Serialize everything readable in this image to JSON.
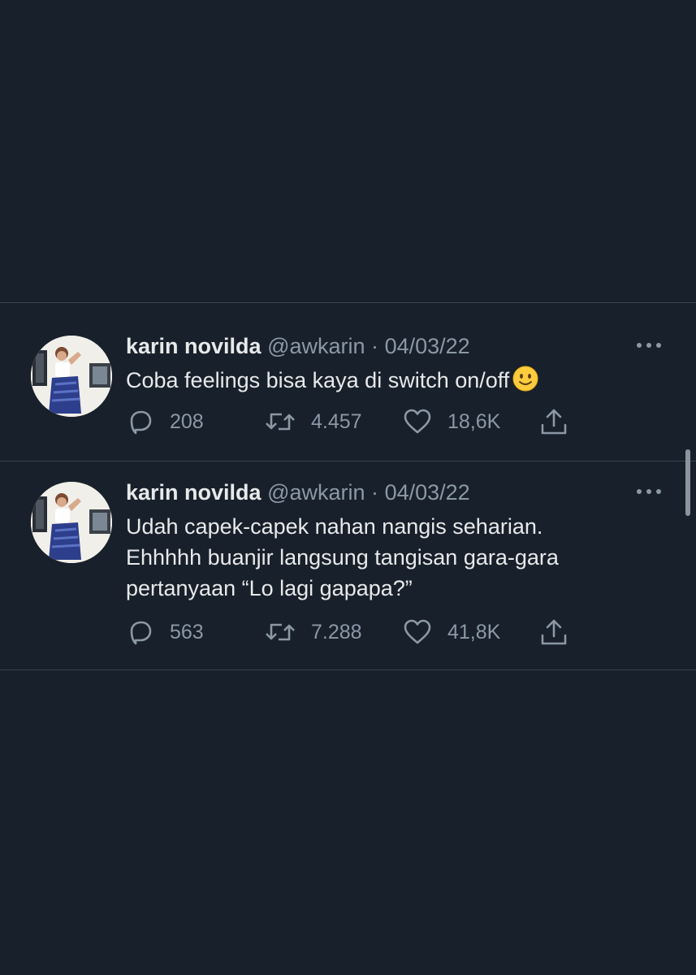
{
  "tweets": [
    {
      "name": "karin novilda",
      "handle": "@awkarin",
      "separator": "·",
      "date": "04/03/22",
      "text_lines": [
        "Coba feelings bisa kaya di switch on/off"
      ],
      "emoji": "slightly-smiling-face",
      "stats": {
        "replies": "208",
        "retweets": "4.457",
        "likes": "18,6K"
      }
    },
    {
      "name": "karin novilda",
      "handle": "@awkarin",
      "separator": "·",
      "date": "04/03/22",
      "text_lines": [
        "Udah capek-capek nahan nangis seharian.",
        "Ehhhhh buanjir langsung tangisan gara-gara",
        "pertanyaan “Lo lagi gapapa?”"
      ],
      "stats": {
        "replies": "563",
        "retweets": "7.288",
        "likes": "41,8K"
      }
    }
  ],
  "icons": {
    "reply": "reply-icon",
    "retweet": "retweet-icon",
    "like": "heart-icon",
    "share": "share-icon",
    "more": "more-icon"
  },
  "colors": {
    "background": "#18202b",
    "text": "#e7e9ea",
    "secondary": "#8b98a5",
    "divider": "#38444d"
  }
}
